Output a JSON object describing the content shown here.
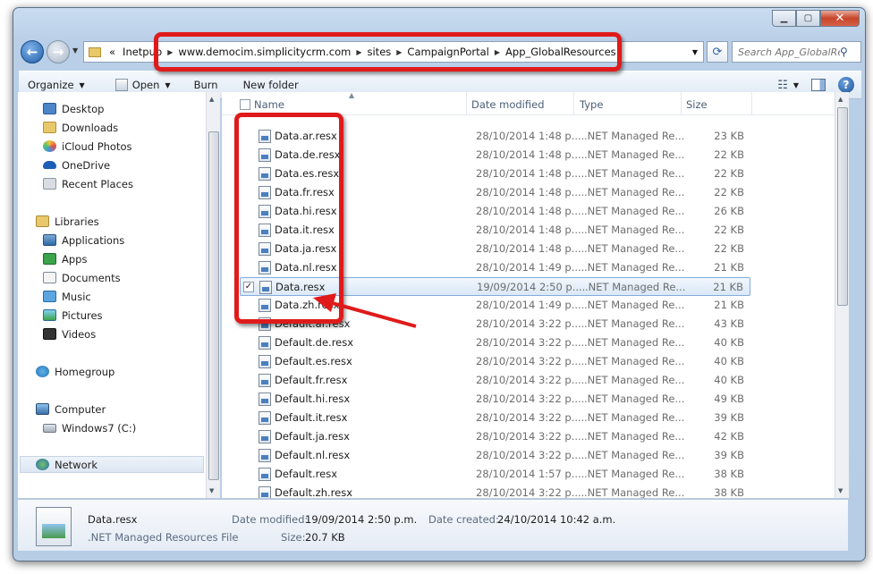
{
  "address": {
    "crumbs": [
      "Inetpub",
      "www.democim.simplicitycrm.com",
      "sites",
      "CampaignPortal",
      "App_GlobalResources"
    ],
    "prefix": "«"
  },
  "search": {
    "placeholder": "Search App_GlobalReso..."
  },
  "toolbar": {
    "organize": "Organize",
    "open": "Open",
    "burn": "Burn",
    "new_folder": "New folder"
  },
  "nav": {
    "favorites": [
      "Desktop",
      "Downloads",
      "iCloud Photos",
      "OneDrive",
      "Recent Places"
    ],
    "libraries": "Libraries",
    "library_items": [
      "Applications",
      "Apps",
      "Documents",
      "Music",
      "Pictures",
      "Videos"
    ],
    "homegroup": "Homegroup",
    "computer": "Computer",
    "drive": "Windows7 (C:)",
    "network": "Network"
  },
  "columns": {
    "name": "Name",
    "date": "Date modified",
    "type": "Type",
    "size": "Size"
  },
  "files": [
    {
      "name": "Data.ar.resx",
      "date": "28/10/2014 1:48 p....",
      "type": ".NET Managed Re...",
      "size": "23 KB"
    },
    {
      "name": "Data.de.resx",
      "date": "28/10/2014 1:48 p....",
      "type": ".NET Managed Re...",
      "size": "22 KB"
    },
    {
      "name": "Data.es.resx",
      "date": "28/10/2014 1:48 p....",
      "type": ".NET Managed Re...",
      "size": "22 KB"
    },
    {
      "name": "Data.fr.resx",
      "date": "28/10/2014 1:48 p....",
      "type": ".NET Managed Re...",
      "size": "22 KB"
    },
    {
      "name": "Data.hi.resx",
      "date": "28/10/2014 1:48 p....",
      "type": ".NET Managed Re...",
      "size": "26 KB"
    },
    {
      "name": "Data.it.resx",
      "date": "28/10/2014 1:48 p....",
      "type": ".NET Managed Re...",
      "size": "22 KB"
    },
    {
      "name": "Data.ja.resx",
      "date": "28/10/2014 1:48 p....",
      "type": ".NET Managed Re...",
      "size": "22 KB"
    },
    {
      "name": "Data.nl.resx",
      "date": "28/10/2014 1:49 p....",
      "type": ".NET Managed Re...",
      "size": "21 KB"
    },
    {
      "name": "Data.resx",
      "date": "19/09/2014 2:50 p....",
      "type": ".NET Managed Re...",
      "size": "21 KB",
      "selected": true
    },
    {
      "name": "Data.zh.resx",
      "date": "28/10/2014 1:49 p....",
      "type": ".NET Managed Re...",
      "size": "21 KB"
    },
    {
      "name": "Default.ar.resx",
      "date": "28/10/2014 3:22 p....",
      "type": ".NET Managed Re...",
      "size": "43 KB"
    },
    {
      "name": "Default.de.resx",
      "date": "28/10/2014 3:22 p....",
      "type": ".NET Managed Re...",
      "size": "40 KB"
    },
    {
      "name": "Default.es.resx",
      "date": "28/10/2014 3:22 p....",
      "type": ".NET Managed Re...",
      "size": "40 KB"
    },
    {
      "name": "Default.fr.resx",
      "date": "28/10/2014 3:22 p....",
      "type": ".NET Managed Re...",
      "size": "40 KB"
    },
    {
      "name": "Default.hi.resx",
      "date": "28/10/2014 3:22 p....",
      "type": ".NET Managed Re...",
      "size": "49 KB"
    },
    {
      "name": "Default.it.resx",
      "date": "28/10/2014 3:22 p....",
      "type": ".NET Managed Re...",
      "size": "39 KB"
    },
    {
      "name": "Default.ja.resx",
      "date": "28/10/2014 3:22 p....",
      "type": ".NET Managed Re...",
      "size": "42 KB"
    },
    {
      "name": "Default.nl.resx",
      "date": "28/10/2014 3:22 p....",
      "type": ".NET Managed Re...",
      "size": "39 KB"
    },
    {
      "name": "Default.resx",
      "date": "28/10/2014 1:57 p....",
      "type": ".NET Managed Re...",
      "size": "38 KB"
    },
    {
      "name": "Default.zh.resx",
      "date": "28/10/2014 3:22 p....",
      "type": ".NET Managed Re...",
      "size": "38 KB"
    }
  ],
  "details": {
    "filename": "Data.resx",
    "filetype": ".NET Managed Resources File",
    "date_modified_label": "Date modified:",
    "date_modified": "19/09/2014 2:50 p.m.",
    "date_created_label": "Date created:",
    "date_created": "24/10/2014 10:42 a.m.",
    "size_label": "Size:",
    "size": "20.7 KB"
  },
  "colors": {
    "annotation": "#e01a1a",
    "selection": "#d9e8f8"
  }
}
